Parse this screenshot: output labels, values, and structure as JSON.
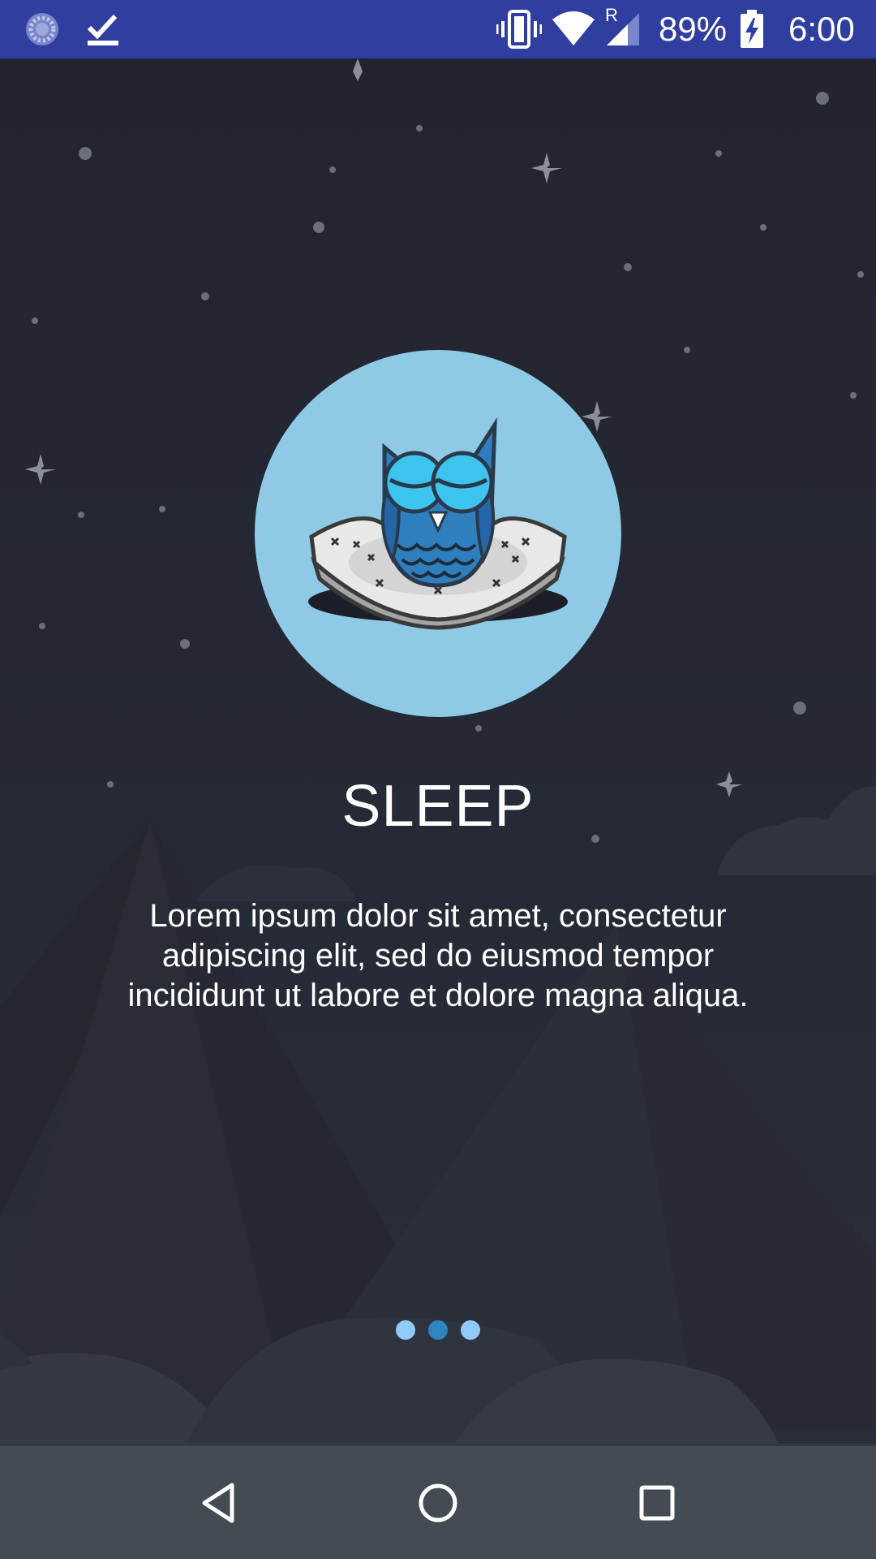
{
  "status_bar": {
    "battery_percent": "89%",
    "time": "6:00",
    "network_badge": "R",
    "icons": [
      "sync-spinner-icon",
      "download-complete-icon",
      "vibrate-icon",
      "wifi-icon",
      "cellular-signal-icon",
      "battery-charging-icon"
    ]
  },
  "onboarding": {
    "title": "SLEEP",
    "description": "Lorem ipsum dolor sit amet, consectetur adipiscing elit, sed do eiusmod tempor incididunt ut labore et dolore magna aliqua.",
    "illustration": "sleeping-owl-on-pillow",
    "pager": {
      "total_pages": 3,
      "current_page": 2
    }
  },
  "colors": {
    "status_bar": "#303f9f",
    "background": "#23252f",
    "illustration_circle": "#8ecae6",
    "dot_active": "#2e86c1",
    "dot_inactive": "#90caf9",
    "nav_bar": "#444b52"
  },
  "nav_bar": {
    "buttons": [
      "back-icon",
      "home-icon",
      "recents-icon"
    ]
  }
}
